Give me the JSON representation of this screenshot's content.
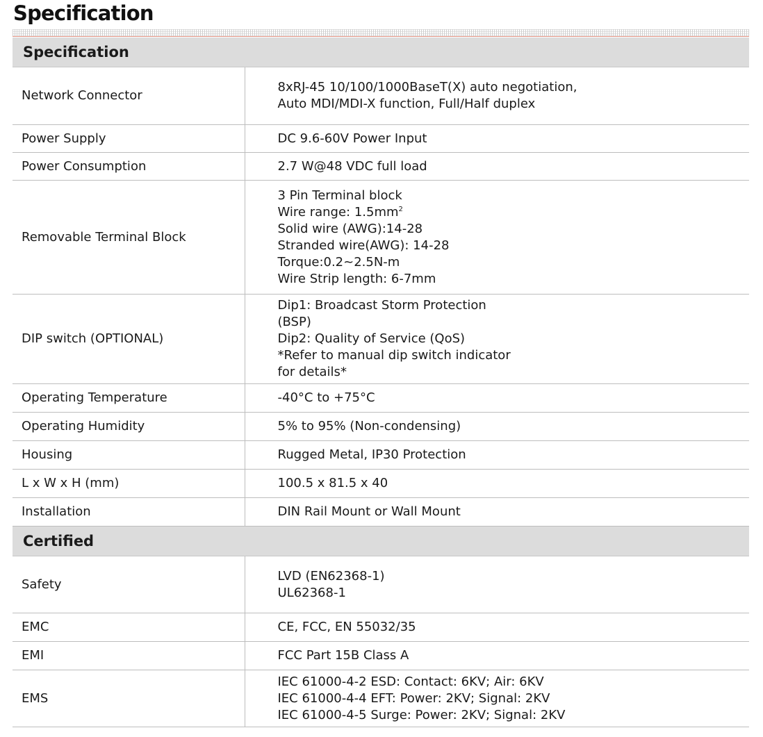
{
  "page": {
    "title": "Specification"
  },
  "sections": {
    "specification": {
      "heading": "Specification",
      "rows": [
        {
          "label": "Network Connector",
          "lines": [
            "8xRJ-45 10/100/1000BaseT(X) auto negotiation,",
            "Auto MDI/MDI-X function, Full/Half duplex"
          ]
        },
        {
          "label": "Power Supply",
          "lines": [
            "DC 9.6-60V Power Input"
          ]
        },
        {
          "label": "Power Consumption",
          "lines": [
            "2.7 W@48 VDC full load"
          ]
        },
        {
          "label": "Removable Terminal Block",
          "lines": [
            "3 Pin Terminal block",
            "Wire range: 1.5mm",
            "Solid wire (AWG):14-28",
            "Stranded wire(AWG): 14-28",
            "Torque:0.2~2.5N-m",
            "Wire Strip length: 6-7mm"
          ],
          "superscript": "2"
        },
        {
          "label": "DIP switch (OPTIONAL)",
          "lines": [
            "Dip1: Broadcast Storm Protection",
            "(BSP)",
            "Dip2: Quality of Service (QoS)",
            "*Refer to manual dip switch indicator",
            "for details*"
          ]
        },
        {
          "label": "Operating Temperature",
          "lines": [
            "-40°C to +75°C"
          ]
        },
        {
          "label": "Operating Humidity",
          "lines": [
            "5% to 95% (Non-condensing)"
          ]
        },
        {
          "label": "Housing",
          "lines": [
            "Rugged Metal, IP30 Protection"
          ]
        },
        {
          "label": "L x W x H (mm)",
          "lines": [
            "100.5 x 81.5 x 40"
          ]
        },
        {
          "label": "Installation",
          "lines": [
            "DIN Rail Mount or Wall Mount"
          ]
        }
      ]
    },
    "certified": {
      "heading": "Certified",
      "rows": [
        {
          "label": "Safety",
          "lines": [
            "LVD (EN62368-1)",
            "UL62368-1"
          ]
        },
        {
          "label": "EMC",
          "lines": [
            "CE, FCC, EN 55032/35"
          ]
        },
        {
          "label": "EMI",
          "lines": [
            "FCC Part 15B Class A"
          ]
        },
        {
          "label": "EMS",
          "lines": [
            "IEC 61000-4-2 ESD: Contact: 6KV; Air: 6KV",
            "IEC 61000-4-4 EFT: Power: 2KV; Signal: 2KV",
            "IEC 61000-4-5 Surge: Power: 2KV; Signal: 2KV"
          ]
        }
      ]
    }
  }
}
